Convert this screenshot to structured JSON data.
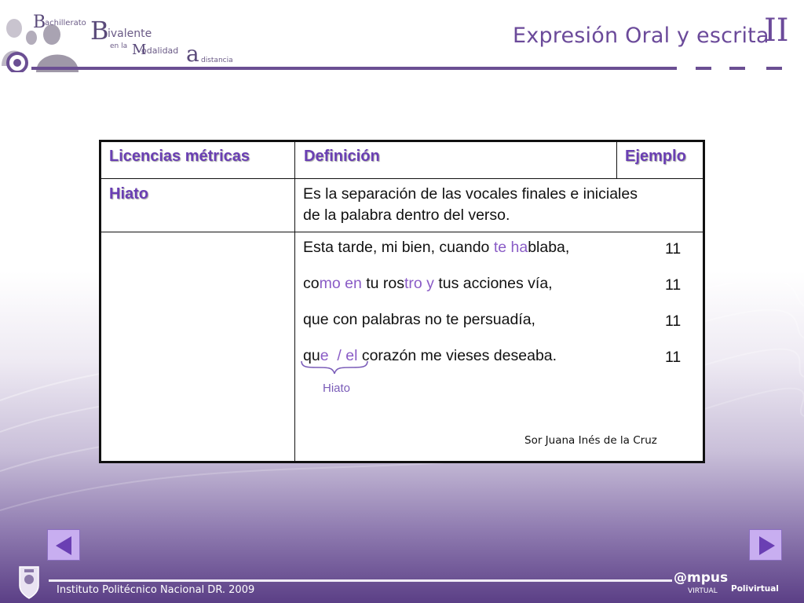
{
  "header": {
    "logo": {
      "b1": "B",
      "achillerato": "achillerato",
      "b2": "B",
      "ivalente": "ivalente",
      "en_la": "en la",
      "m": "M",
      "odalidad": "odalidad",
      "a": "a",
      "distancia": "distancia"
    },
    "title": "Expresión Oral  y escrita",
    "roman": "II"
  },
  "table": {
    "headers": [
      "Licencias métricas",
      "Definición",
      "Ejemplo"
    ],
    "row1": {
      "term": "Hiato",
      "definition_line1": "Es la separación de las vocales finales e iniciales",
      "definition_line2": "de la palabra dentro del verso."
    },
    "verses": [
      {
        "parts": [
          {
            "t": "Esta tarde, mi bien, cuando ",
            "hl": false
          },
          {
            "t": "te ha",
            "hl": true
          },
          {
            "t": "blaba,",
            "hl": false
          }
        ],
        "count": "11"
      },
      {
        "parts": [
          {
            "t": "co",
            "hl": false
          },
          {
            "t": "mo en",
            "hl": true
          },
          {
            "t": " tu ros",
            "hl": false
          },
          {
            "t": "tro y",
            "hl": true
          },
          {
            "t": " tus acciones vía,",
            "hl": false
          }
        ],
        "count": "11"
      },
      {
        "parts": [
          {
            "t": "que con palabras no te persuadía,",
            "hl": false
          }
        ],
        "count": "11"
      },
      {
        "parts": [
          {
            "t": "qu",
            "hl": false
          },
          {
            "t": "e  / el",
            "hl": true
          },
          {
            "t": " corazón me vieses deseaba.",
            "hl": false
          }
        ],
        "count": "11"
      }
    ],
    "hiato_note": "Hiato",
    "author": "Sor Juana Inés de la Cruz"
  },
  "footer": {
    "institution": "Instituto Politécnico Nacional DR. 2009",
    "campus": "@mpus",
    "campus_sub": "VIRTUAL",
    "polivirtual": "Polivirtual"
  },
  "colors": {
    "accent": "#6b4a9a",
    "highlight": "#8a5cc6",
    "nav_button": "#c8aef0"
  }
}
